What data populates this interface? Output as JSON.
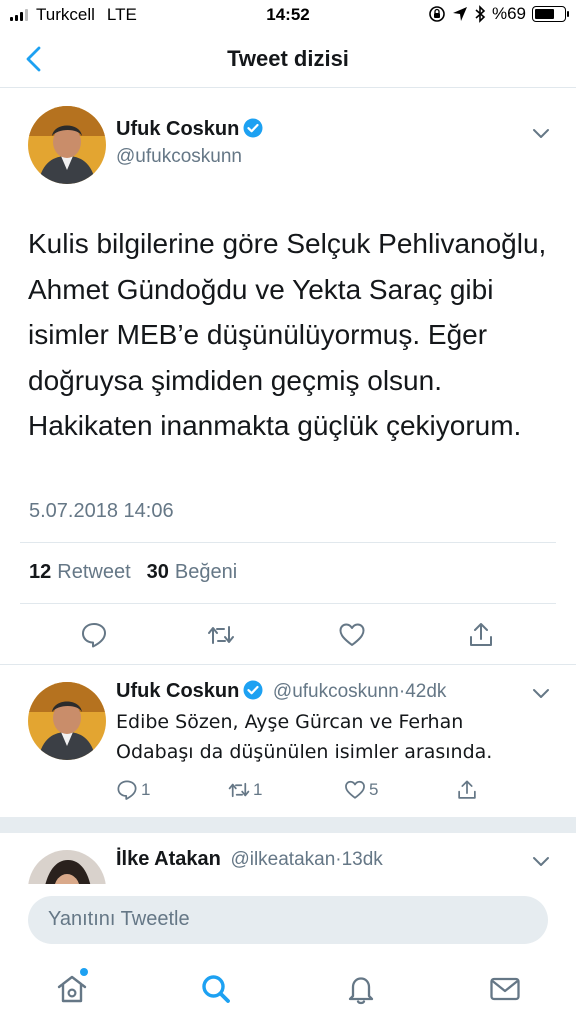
{
  "status_bar": {
    "carrier": "Turkcell",
    "network": "LTE",
    "time": "14:52",
    "battery": "%69",
    "battery_level": 0.69
  },
  "nav": {
    "title": "Tweet dizisi",
    "back_icon": "chevron-left-icon"
  },
  "main_tweet": {
    "author_name": "Ufuk Coskun",
    "author_handle": "@ufukcoskunn",
    "text": "Kulis bilgilerine göre Selçuk Pehlivanoğlu, Ahmet Gündoğdu ve Yekta Saraç gibi isimler MEB’e düşünülüyormuş. Eğer doğruysa şimdiden geçmiş olsun. Hakikaten inanmakta güçlük çekiyorum.",
    "timestamp": "5.07.2018 14:06",
    "retweet_count": "12",
    "retweet_label": "Retweet",
    "like_count": "30",
    "like_label": "Beğeni"
  },
  "reply_tweet": {
    "author_name": "Ufuk Coskun",
    "author_handle": "@ufukcoskunn",
    "age": "·42dk",
    "text": "Edibe Sözen, Ayşe Gürcan ve Ferhan Odabaşı da düşünülen isimler arasında.",
    "reply_count": "1",
    "retweet_count": "1",
    "like_count": "5"
  },
  "next_tweet": {
    "author_name": "İlke Atakan",
    "author_handle": "@ilkeatakan",
    "age": "·13dk"
  },
  "compose": {
    "placeholder": "Yanıtını Tweetle"
  },
  "tab_bar": {
    "tabs": [
      "home-icon",
      "search-icon",
      "notifications-icon",
      "messages-icon"
    ]
  },
  "colors": {
    "accent": "#1da1f2",
    "secondary_text": "#657786",
    "primary_text": "#14171a",
    "divider": "#e1e8ed"
  }
}
